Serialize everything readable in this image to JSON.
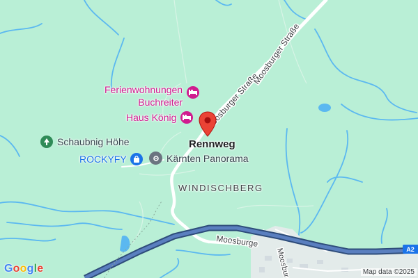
{
  "map": {
    "colors": {
      "land": "#b9efd6",
      "water": "#5bb8f0",
      "highway": "#4a6fa8",
      "highway_casing": "#2e4c7a",
      "road": "#ffffff",
      "poi_pink": "#d01b8f",
      "poi_blue": "#1a73e8",
      "pin": "#ea4335"
    },
    "labels": {
      "road_upper_a": "Moosburger Straße",
      "road_upper_b": "Moosburger Straße",
      "road_lower": "Moosburger Straße",
      "road_south": "Moosburger Straße",
      "locality": "WINDISCHBERG",
      "town": "Rennweg"
    },
    "pois": {
      "ferien": {
        "line1": "Ferienwohnungen",
        "line2": "Buchreiter",
        "icon": "bed-icon"
      },
      "haus_koenig": {
        "name": "Haus König",
        "icon": "bed-icon"
      },
      "schaubnig": {
        "name": "Schaubnig Höhe",
        "icon": "park-icon"
      },
      "rockyfy": {
        "name": "ROCKYFY",
        "icon": "shopping-bag-icon"
      },
      "panorama": {
        "name": "Kärnten Panorama",
        "icon": "pin-dot-icon"
      }
    },
    "highway_shield": "A2",
    "attribution": "Map data ©2025",
    "logo": {
      "letters": [
        "G",
        "o",
        "o",
        "g",
        "l",
        "e"
      ],
      "colors": [
        "#4285f4",
        "#ea4335",
        "#fbbc05",
        "#4285f4",
        "#34a853",
        "#ea4335"
      ]
    }
  }
}
